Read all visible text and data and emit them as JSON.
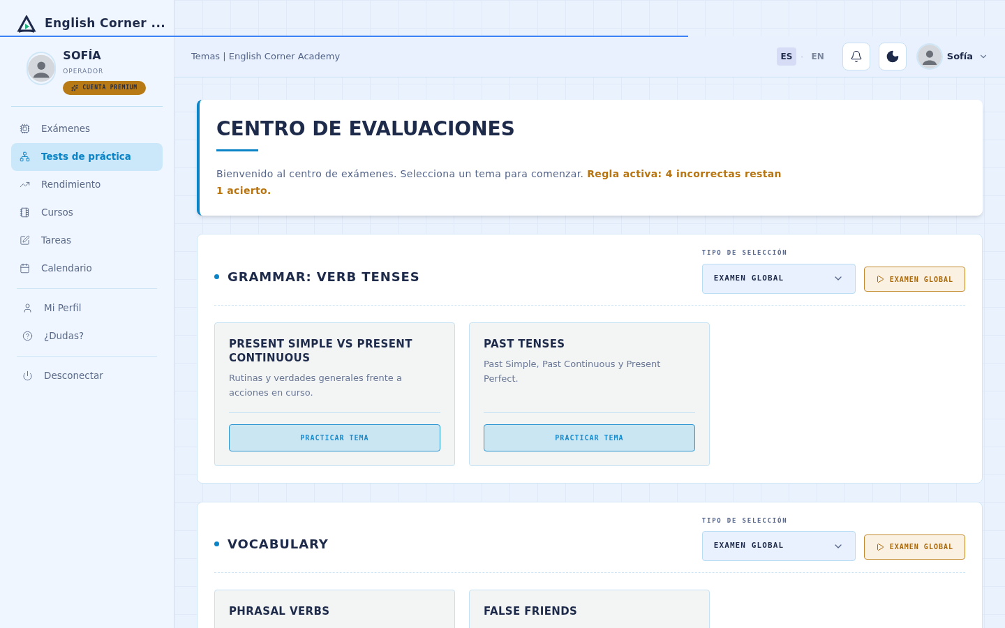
{
  "app": {
    "title": "English Corner ..."
  },
  "user": {
    "name": "SOFÍA",
    "role": "OPERADOR",
    "badge": "CUENTA PREMIUM"
  },
  "nav_groups": [
    [
      {
        "label": "Exámenes",
        "selected": false
      },
      {
        "label": "Tests de práctica",
        "selected": true
      },
      {
        "label": "Rendimiento",
        "selected": false
      },
      {
        "label": "Cursos",
        "selected": false
      },
      {
        "label": "Tareas",
        "selected": false
      },
      {
        "label": "Calendario",
        "selected": false
      }
    ],
    [
      {
        "label": "Mi Perfil",
        "selected": false
      },
      {
        "label": "¿Dudas?",
        "selected": false
      }
    ],
    [
      {
        "label": "Desconectar",
        "selected": false
      }
    ]
  ],
  "header": {
    "breadcrumb": "Temas | English Corner Academy",
    "languages": [
      {
        "label": "ES",
        "selected": true
      },
      {
        "label": "EN",
        "selected": false
      }
    ],
    "separator": "·",
    "user_name": "Sofía"
  },
  "intro": {
    "title": "CENTRO DE EVALUACIONES",
    "text": "Bienvenido al centro de exámenes. Selecciona un tema para comenzar. ",
    "rule": "Regla activa: 4 incorrectas restan 1 acierto."
  },
  "sections": [
    {
      "title": "GRAMMAR: VERB TENSES",
      "select_label": "TIPO DE SELECCIÓN",
      "select_value": "EXAMEN GLOBAL",
      "button": "EXAMEN GLOBAL",
      "topics": [
        {
          "title": "PRESENT SIMPLE VS PRESENT CONTINUOUS",
          "description": "Rutinas y verdades generales frente a acciones en curso.",
          "button": "PRACTICAR TEMA"
        },
        {
          "title": "PAST TENSES",
          "description": "Past Simple, Past Continuous y Present Perfect.",
          "button": "PRACTICAR TEMA"
        }
      ]
    },
    {
      "title": "VOCABULARY",
      "select_label": "TIPO DE SELECCIÓN",
      "select_value": "EXAMEN GLOBAL",
      "button": "EXAMEN GLOBAL",
      "topics": [
        {
          "title": "PHRASAL VERBS"
        },
        {
          "title": "FALSE FRIENDS"
        }
      ]
    }
  ]
}
